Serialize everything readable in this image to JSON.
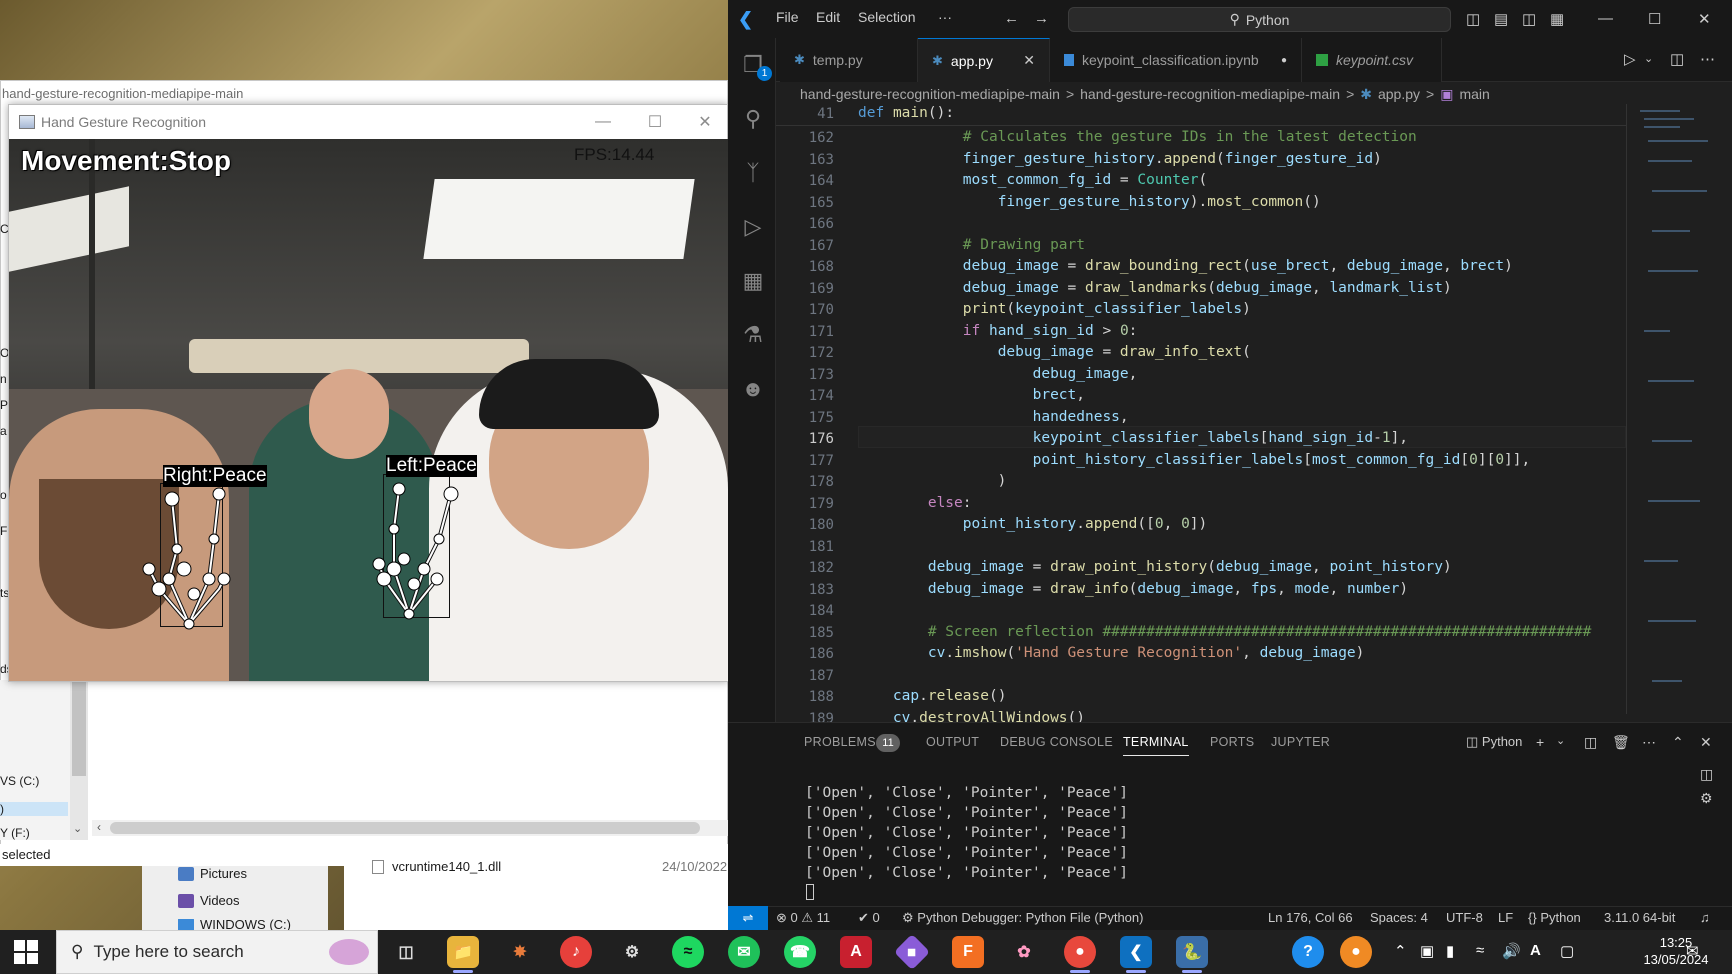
{
  "explorer": {
    "title": "hand-gesture-recognition-mediapipe-main",
    "sidebar_fragments": [
      "Cli",
      "Ori",
      "n",
      "P",
      "a",
      "o",
      "F",
      "ts",
      "ds"
    ],
    "drive_c": "VS (C:)",
    "drive_selected": ")",
    "drive_e": "Y (F:)",
    "status": "selected",
    "nav_items": [
      "Pictures",
      "Videos",
      "WINDOWS (C:)"
    ],
    "file_name": "vcruntime140_1.dll",
    "file_date": "24/10/2022"
  },
  "camera_window": {
    "title": "Hand Gesture Recognition",
    "movement_text": "Movement:Stop",
    "fps_text": "FPS:14.44",
    "right_label": "Right:Peace",
    "left_label": "Left:Peace"
  },
  "vscode": {
    "menu": [
      "File",
      "Edit",
      "Selection",
      "···"
    ],
    "search_text": "Python",
    "tabs": [
      {
        "label": "temp.py",
        "type": "py"
      },
      {
        "label": "app.py",
        "type": "py",
        "active": true
      },
      {
        "label": "keypoint_classification.ipynb",
        "type": "ipynb",
        "modified": true
      },
      {
        "label": "keypoint.csv",
        "type": "csv"
      }
    ],
    "breadcrumb": [
      "hand-gesture-recognition-mediapipe-main",
      ">",
      "hand-gesture-recognition-mediapipe-main",
      ">",
      "app.py",
      ">",
      "main"
    ],
    "sticky_line_no": "41",
    "line_numbers": [
      "162",
      "163",
      "164",
      "165",
      "166",
      "167",
      "168",
      "169",
      "170",
      "171",
      "172",
      "173",
      "174",
      "175",
      "176",
      "177",
      "178",
      "179",
      "180",
      "181",
      "182",
      "183",
      "184",
      "185",
      "186",
      "187",
      "188",
      "189"
    ],
    "current_line": "176",
    "panel_tabs": [
      "PROBLEMS",
      "OUTPUT",
      "DEBUG CONSOLE",
      "TERMINAL",
      "PORTS",
      "JUPYTER"
    ],
    "problems_count": "11",
    "terminal_profile": "Python",
    "terminal_lines": [
      "['Open', 'Close', 'Pointer', 'Peace']",
      "['Open', 'Close', 'Pointer', 'Peace']",
      "['Open', 'Close', 'Pointer', 'Peace']",
      "['Open', 'Close', 'Pointer', 'Peace']",
      "['Open', 'Close', 'Pointer', 'Peace']"
    ],
    "status": {
      "errors": "0",
      "warnings": "11",
      "ports": "0",
      "debugger": "Python Debugger: Python File (Python)",
      "position": "Ln 176, Col 66",
      "spaces": "Spaces: 4",
      "encoding": "UTF-8",
      "eol": "LF",
      "language": "Python",
      "interpreter": "3.11.0 64-bit"
    }
  },
  "taskbar": {
    "search_placeholder": "Type here to search",
    "time": "13:25",
    "date": "13/05/2024"
  }
}
